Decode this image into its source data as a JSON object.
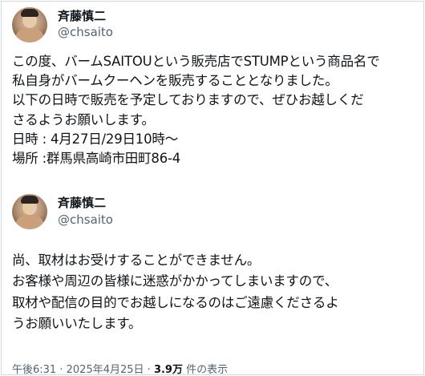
{
  "posts": [
    {
      "name": "斉藤慎二",
      "handle": "@chsaito",
      "lines": [
        "この度、バームSAITOUという販売店でSTUMPという商品名で",
        "私自身がバームクーヘンを販売することとなりました。",
        "以下の日時で販売を予定しておりますので、ぜひお越しくだ",
        "さるようお願いします。",
        "日時 : 4月27日/29日10時〜",
        "場所 :群馬県高崎市田町86-4"
      ]
    },
    {
      "name": "斉藤慎二",
      "handle": "@chsaito",
      "lines": [
        "尚、取材はお受けすることができません。",
        "お客様や周辺の皆様に迷惑がかかってしまいますので、",
        "取材や配信の目的でお越しになるのはご遠慮くださるよ",
        "うお願いいたします。"
      ]
    }
  ],
  "meta": {
    "time": "午後6:31",
    "sep1": "·",
    "date": "2025年4月25日",
    "sep2": "·",
    "views": "3.9万",
    "views_label": "件の表示"
  }
}
